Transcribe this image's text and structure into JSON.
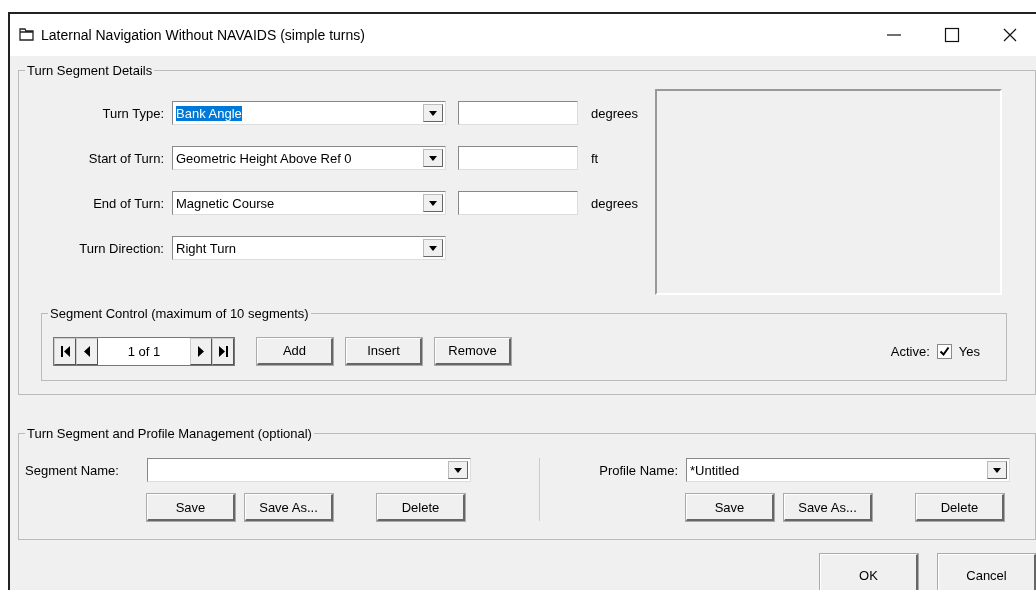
{
  "window": {
    "title": "Laternal Navigation Without NAVAIDS (simple turns)"
  },
  "turn_segment_details": {
    "title": "Turn Segment Details",
    "rows": [
      {
        "label": "Turn Type:",
        "value": "Bank Angle",
        "highlighted": true,
        "unit": "degrees"
      },
      {
        "label": "Start of Turn:",
        "value": "Geometric Height Above Ref 0",
        "highlighted": false,
        "unit": "ft"
      },
      {
        "label": "End of Turn:",
        "value": "Magnetic Course",
        "highlighted": false,
        "unit": "degrees"
      },
      {
        "label": "Turn Direction:",
        "value": "Right Turn",
        "highlighted": false
      }
    ]
  },
  "segment_control": {
    "title": "Segment Control  (maximum of 10 segments)",
    "position": "1 of 1",
    "buttons": [
      "Add",
      "Insert",
      "Remove"
    ],
    "active": {
      "label": "Active:",
      "checked": true,
      "text": "Yes"
    }
  },
  "management": {
    "title": "Turn Segment and Profile Management (optional)",
    "panels": [
      {
        "label": "Segment Name:",
        "buttons": [
          "Save",
          "Save As...",
          "Delete"
        ]
      },
      {
        "label": "Profile Name:",
        "value": "*Untitled",
        "buttons": [
          "Save",
          "Save As...",
          "Delete"
        ]
      }
    ]
  },
  "buttons": [
    "OK",
    "Cancel"
  ]
}
